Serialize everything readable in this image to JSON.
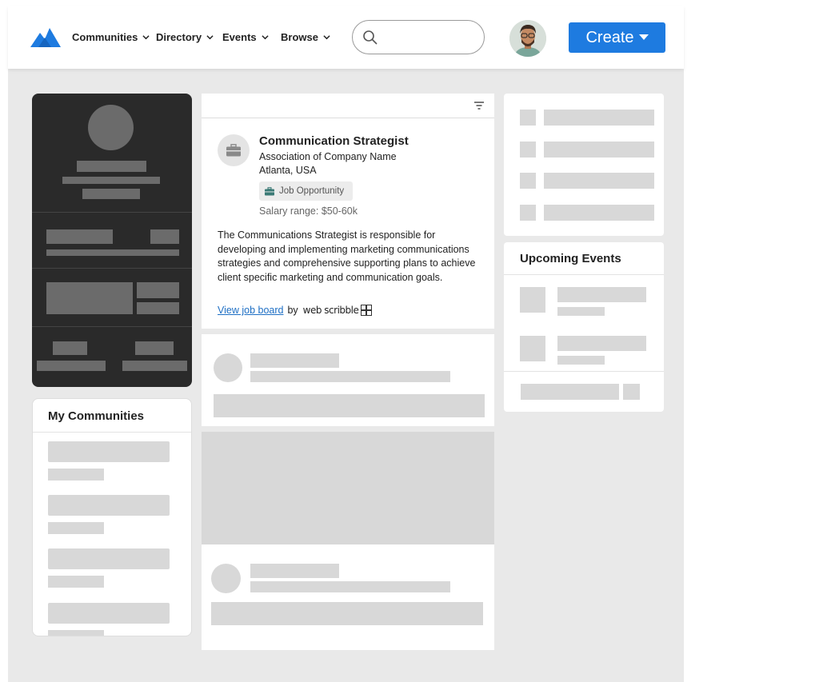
{
  "nav": {
    "items": [
      {
        "label": "Communities"
      },
      {
        "label": "Directory"
      },
      {
        "label": "Events"
      },
      {
        "label": "Browse"
      }
    ],
    "create_label": "Create"
  },
  "sidebar": {
    "my_communities_title": "My Communities"
  },
  "job_post": {
    "title": "Communication Strategist",
    "company": "Association of Company Name",
    "location": "Atlanta, USA",
    "badge": "Job Opportunity",
    "salary": "Salary range: $50-60k",
    "description": "The Communications Strategist is responsible for developing and implementing marketing communications strategies and comprehensive supporting plans to achieve client specific marketing and communication goals.",
    "link_text": "View job board",
    "by_text": "by",
    "brand": "web scribble"
  },
  "right": {
    "events_title": "Upcoming Events"
  },
  "colors": {
    "accent": "#1e7be0",
    "link": "#1e6fc4",
    "background": "#e9e9e9",
    "profile_card": "#2a2a2a",
    "skeleton": "#d8d8d8"
  },
  "icons": [
    "logo-mountain-icon",
    "chevron-down-icon",
    "search-icon",
    "avatar",
    "caret-down-icon",
    "filter-icon",
    "briefcase-icon",
    "grid-logo-icon"
  ]
}
